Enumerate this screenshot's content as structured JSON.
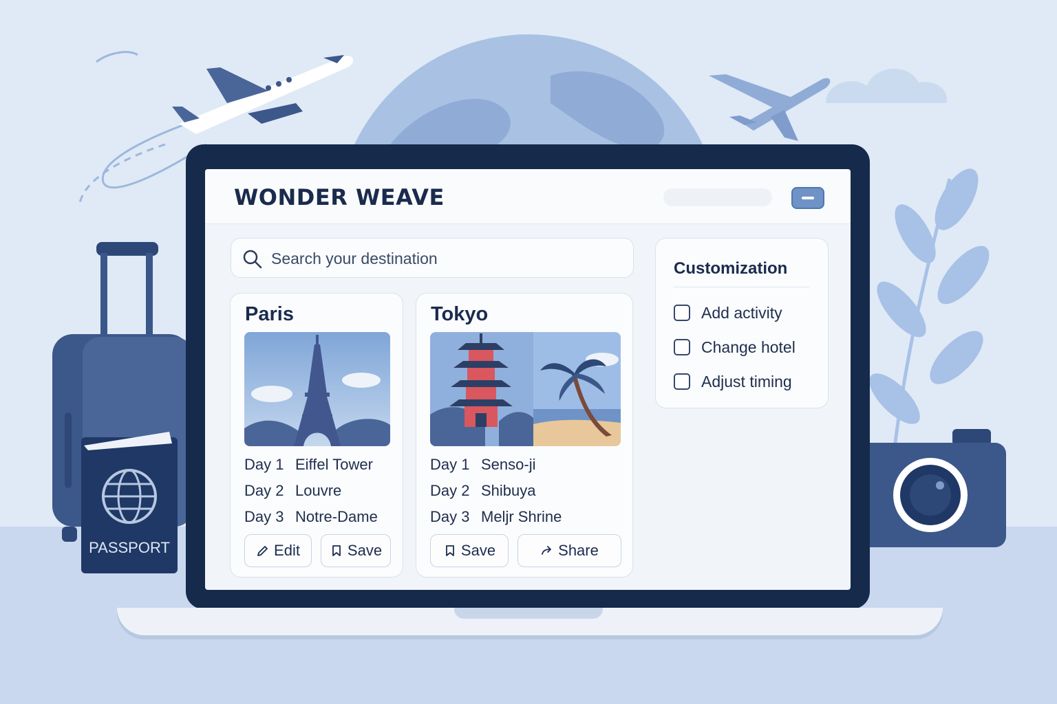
{
  "app": {
    "brand": "WONDER WEAVE"
  },
  "search": {
    "placeholder": "Search your destination",
    "value": ""
  },
  "cards": [
    {
      "title": "Paris",
      "days": [
        {
          "day": "Day 1",
          "place": "Eiffel Tower"
        },
        {
          "day": "Day 2",
          "place": "Louvre"
        },
        {
          "day": "Day 3",
          "place": "Notre-Dame"
        }
      ],
      "actions": [
        {
          "label": "Edit",
          "icon": "pencil-icon"
        },
        {
          "label": "Save",
          "icon": "bookmark-icon"
        }
      ]
    },
    {
      "title": "Tokyo",
      "days": [
        {
          "day": "Day 1",
          "place": "Senso-ji"
        },
        {
          "day": "Day 2",
          "place": "Shibuya"
        },
        {
          "day": "Day 3",
          "place": "Meljr Shrine"
        }
      ],
      "actions": [
        {
          "label": "Save",
          "icon": "bookmark-icon"
        },
        {
          "label": "Share",
          "icon": "share-arrow-icon"
        }
      ]
    }
  ],
  "customization": {
    "title": "Customization",
    "options": [
      {
        "label": "Add activity",
        "checked": false
      },
      {
        "label": "Change hotel",
        "checked": false
      },
      {
        "label": "Adjust timing",
        "checked": false
      }
    ]
  },
  "background": {
    "passport_text": "PASSPORT"
  },
  "colors": {
    "navy": "#162a4c",
    "accent": "#6f93c7",
    "sky": "#dfeaf6"
  }
}
